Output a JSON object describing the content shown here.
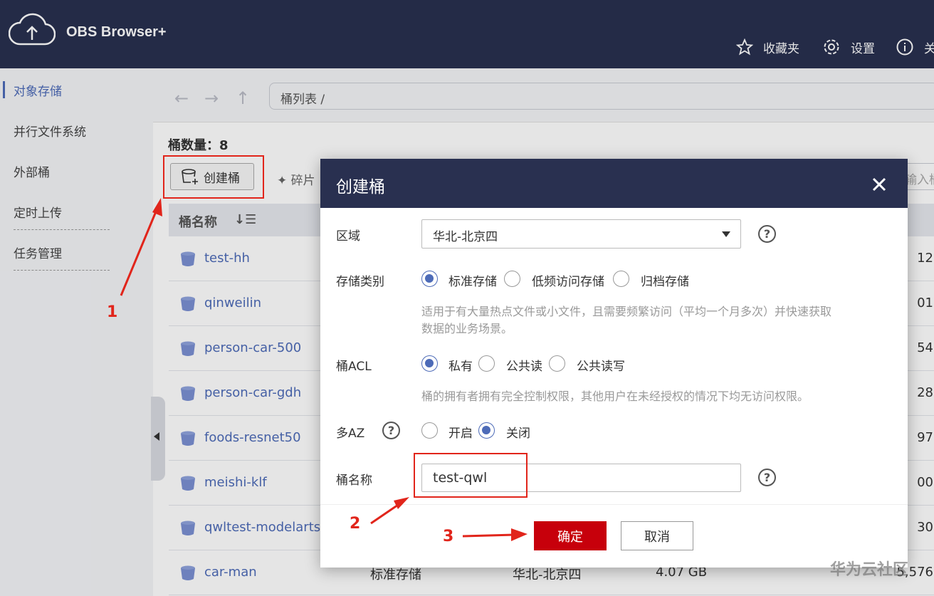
{
  "app": {
    "title": "OBS Browser+"
  },
  "header": {
    "favorites": "收藏夹",
    "settings": "设置",
    "about": "关"
  },
  "sidebar": {
    "items": [
      {
        "label": "对象存储"
      },
      {
        "label": "并行文件系统"
      },
      {
        "label": "外部桶"
      },
      {
        "label": "定时上传"
      },
      {
        "label": "任务管理"
      }
    ]
  },
  "toolbar": {
    "path": "桶列表 /"
  },
  "main": {
    "bucket_count": "桶数量：8",
    "create_label": "创建桶",
    "frag_label": "碎片",
    "search_placeholder": "输入桶",
    "col_name": "桶名称",
    "buckets": [
      {
        "name": "test-hh",
        "tail": "12"
      },
      {
        "name": "qinweilin",
        "tail": "01"
      },
      {
        "name": "person-car-500",
        "tail": "54"
      },
      {
        "name": "person-car-gdh",
        "tail": "28"
      },
      {
        "name": "foods-resnet50",
        "tail": "97"
      },
      {
        "name": "meishi-klf",
        "tail": "00"
      },
      {
        "name": "qwltest-modelarts",
        "tail": "30"
      },
      {
        "name": "car-man",
        "storage": "标准存储",
        "region": "华北-北京四",
        "size": "4.07 GB",
        "tail": "5,576"
      }
    ]
  },
  "dialog": {
    "title": "创建桶",
    "region_label": "区域",
    "region_value": "华北-北京四",
    "storage_label": "存储类别",
    "storage_options": [
      "标准存储",
      "低频访问存储",
      "归档存储"
    ],
    "storage_desc_1": "适用于有大量热点文件或小文件，且需要频繁访问（平均一个月多次）并快速获取",
    "storage_desc_2": "数据的业务场景。",
    "acl_label": "桶ACL",
    "acl_options": [
      "私有",
      "公共读",
      "公共读写"
    ],
    "acl_desc": "桶的拥有者拥有完全控制权限，其他用户在未经授权的情况下均无访问权限。",
    "az_label": "多AZ",
    "az_options": [
      "开启",
      "关闭"
    ],
    "name_label": "桶名称",
    "name_value": "test-qwl",
    "ok": "确定",
    "cancel": "取消",
    "help": "?"
  },
  "annotations": {
    "step1": "1",
    "step2": "2",
    "step3": "3"
  },
  "watermark": "华为云社区",
  "colors": {
    "header": "#293050",
    "accent": "#4d6bb8",
    "ok": "#c7000b",
    "annotation": "#e1251b"
  }
}
